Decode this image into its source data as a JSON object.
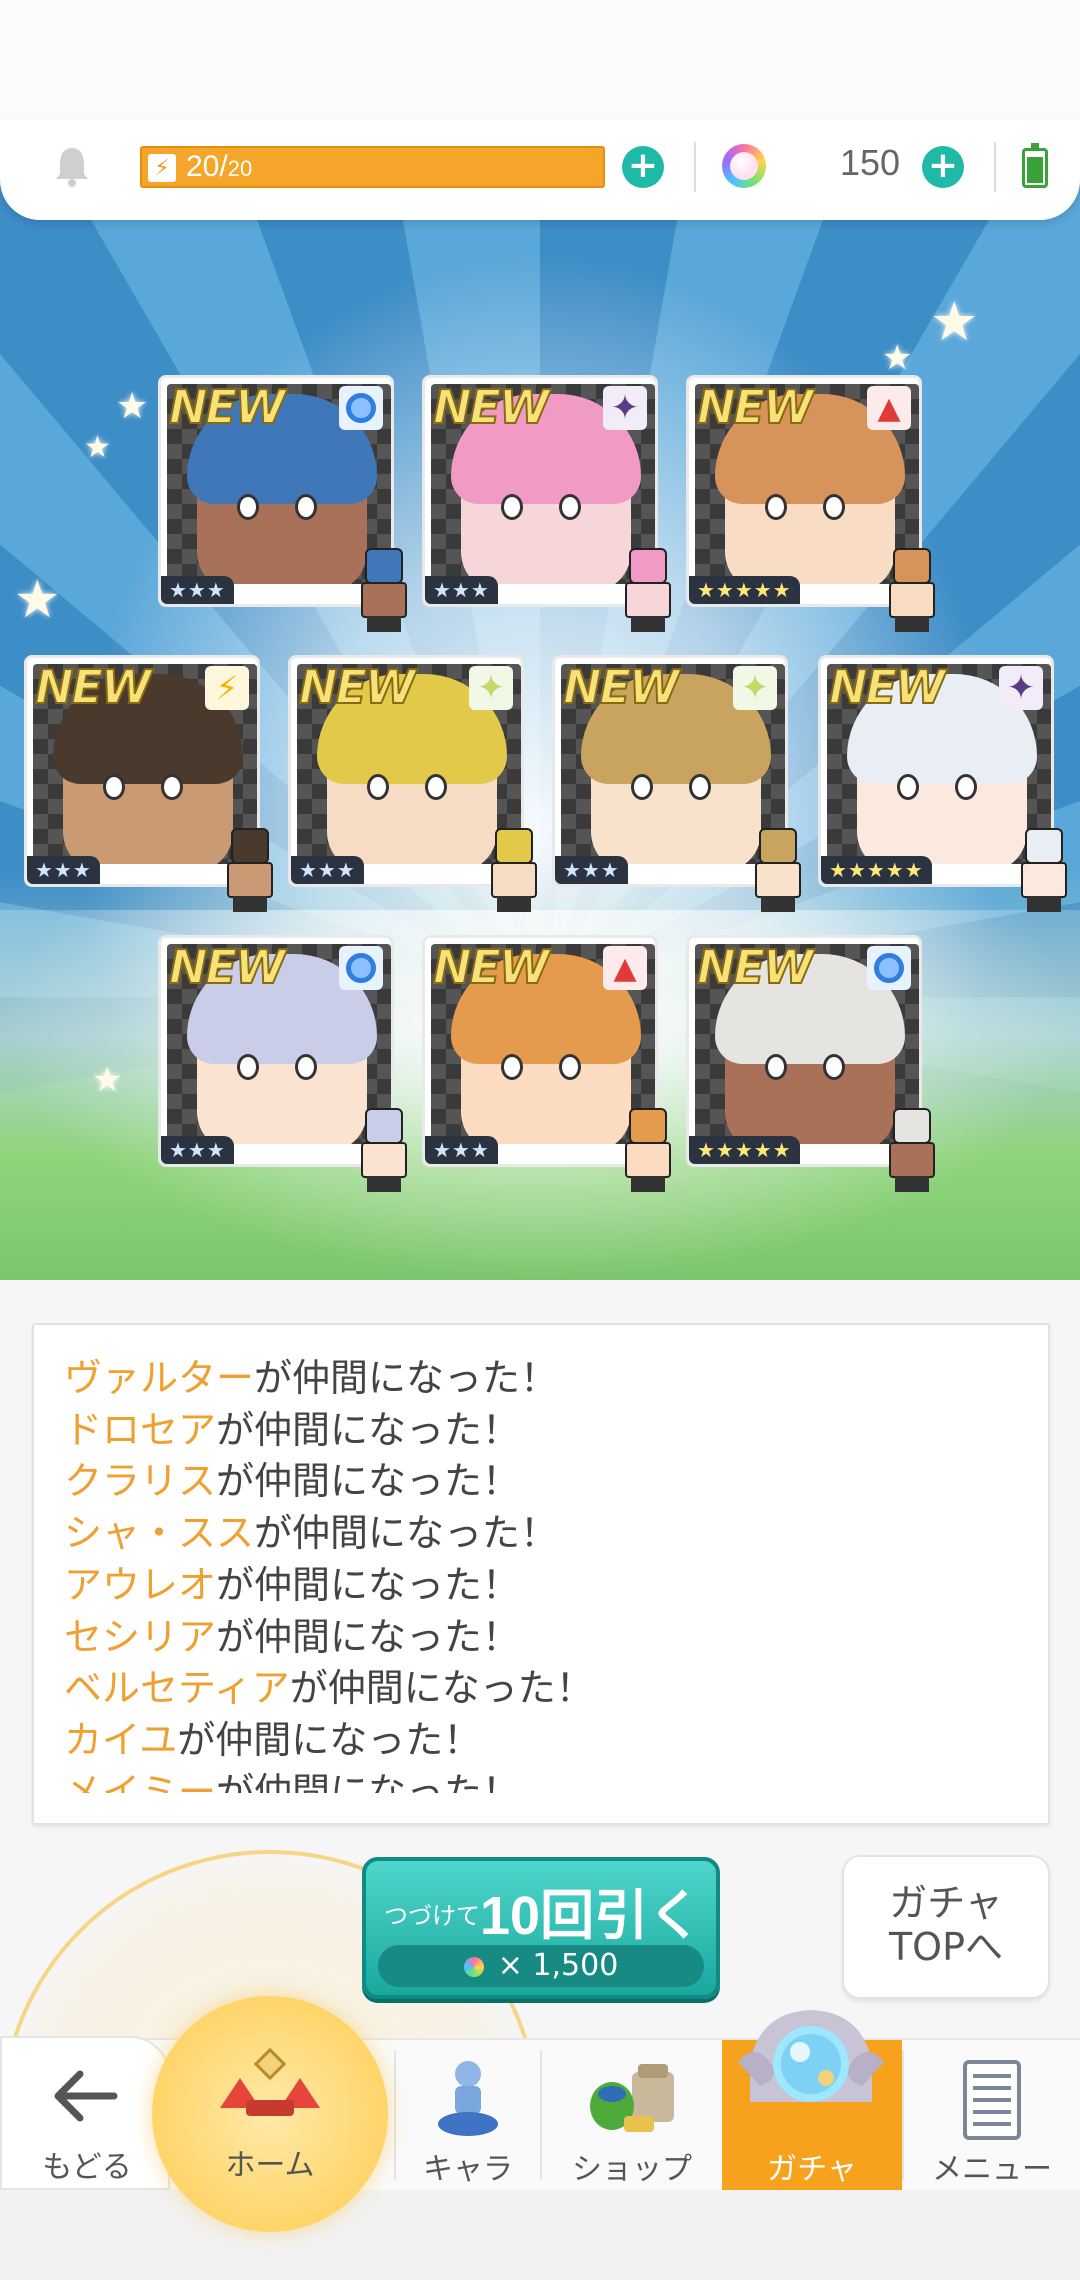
{
  "status": {
    "stamina_current": "20",
    "stamina_max": "20",
    "gems": "150"
  },
  "cards": [
    {
      "new": "NEW",
      "attr": "blue",
      "stars": "★★★",
      "rarity": 3,
      "hair": "#3f77b8",
      "skin": "#a8715a"
    },
    {
      "new": "NEW",
      "attr": "purple",
      "stars": "★★★",
      "rarity": 3,
      "hair": "#f29ac6",
      "skin": "#f6d6d9"
    },
    {
      "new": "NEW",
      "attr": "red",
      "stars": "★★★★★",
      "rarity": 5,
      "hair": "#d6945a",
      "skin": "#f8dcc4"
    },
    {
      "new": "NEW",
      "attr": "yellow",
      "stars": "★★★",
      "rarity": 3,
      "hair": "#4a3a2e",
      "skin": "#c99a74"
    },
    {
      "new": "NEW",
      "attr": "green",
      "stars": "★★★",
      "rarity": 3,
      "hair": "#e2c94a",
      "skin": "#f5dcc3"
    },
    {
      "new": "NEW",
      "attr": "green",
      "stars": "★★★",
      "rarity": 3,
      "hair": "#c9a45e",
      "skin": "#f9e2cc"
    },
    {
      "new": "NEW",
      "attr": "purple",
      "stars": "★★★★★",
      "rarity": 5,
      "hair": "#e8eef4",
      "skin": "#fbe8de"
    },
    {
      "new": "NEW",
      "attr": "blue",
      "stars": "★★★",
      "rarity": 3,
      "hair": "#c9cde8",
      "skin": "#fbe3d2"
    },
    {
      "new": "NEW",
      "attr": "red",
      "stars": "★★★",
      "rarity": 3,
      "hair": "#e59b4d",
      "skin": "#fbdcc0"
    },
    {
      "new": "NEW",
      "attr": "blue",
      "stars": "★★★★★",
      "rarity": 5,
      "hair": "#e6e4e1",
      "skin": "#a87158"
    }
  ],
  "log": [
    {
      "name": "ヴァルター",
      "suffix": "が仲間になった！"
    },
    {
      "name": "ドロセア",
      "suffix": "が仲間になった！"
    },
    {
      "name": "クラリス",
      "suffix": "が仲間になった！"
    },
    {
      "name": "シャ・スス",
      "suffix": "が仲間になった！"
    },
    {
      "name": "アウレオ",
      "suffix": "が仲間になった！"
    },
    {
      "name": "セシリア",
      "suffix": "が仲間になった！"
    },
    {
      "name": "ベルセティア",
      "suffix": "が仲間になった！"
    },
    {
      "name": "カイユ",
      "suffix": "が仲間になった！"
    },
    {
      "name": "メイミー",
      "suffix": "が仲間になった！"
    }
  ],
  "pull_button": {
    "prefix": "つづけて",
    "label": "10回引く",
    "cost": "× 1,500"
  },
  "gacha_top_button": {
    "line1": "ガチャ",
    "line2": "TOPへ"
  },
  "nav": {
    "back": "もどる",
    "home": "ホーム",
    "chara": "キャラ",
    "shop": "ショップ",
    "gacha": "ガチャ",
    "menu": "メニュー"
  },
  "colors": {
    "accent_teal": "#1fb9a8",
    "stamina_orange": "#f5a52a",
    "name_orange": "#f0a030",
    "active_tab": "#f6a21c"
  }
}
